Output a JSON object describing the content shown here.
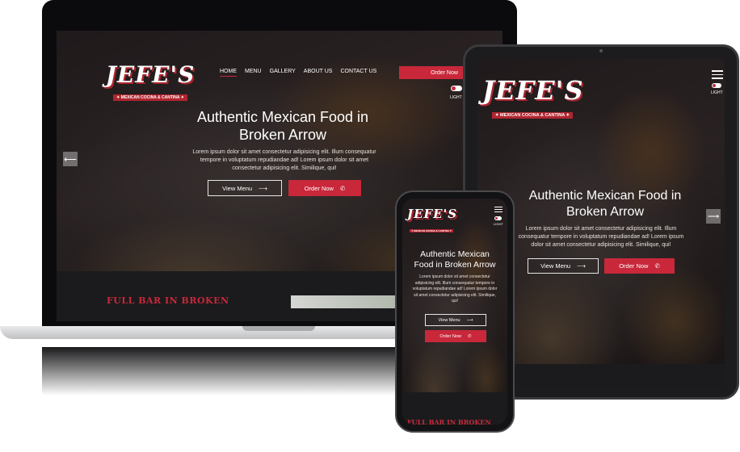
{
  "brand": {
    "logo_word": "JEFE'S",
    "logo_tagline": "✦ MEXICAN COCINA & CANTINA ✦"
  },
  "nav": {
    "items": [
      "HOME",
      "MENU",
      "GALLERY",
      "ABOUT US",
      "CONTACT US"
    ],
    "order_now": "Order Now"
  },
  "hero": {
    "title_line1": "Authentic Mexican Food in",
    "title_line2": "Broken Arrow",
    "body": "Lorem ipsum dolor sit amet consectetur adipisicing elit. Illum consequatur tempore in voluptatum repudiandae ad! Lorem ipsum dolor sit amet consectetur adipisicing elit. Similique, qui!",
    "view_menu": "View Menu",
    "order_now": "Order Now"
  },
  "phone_hero": {
    "title_line1": "Authentic Mexican",
    "title_line2": "Food in Broken Arrow"
  },
  "theme_toggle_label": "LIGHT",
  "section_heading": "FULL BAR IN BROKEN",
  "colors": {
    "accent": "#c8283a",
    "dark": "#1b1b1d"
  }
}
